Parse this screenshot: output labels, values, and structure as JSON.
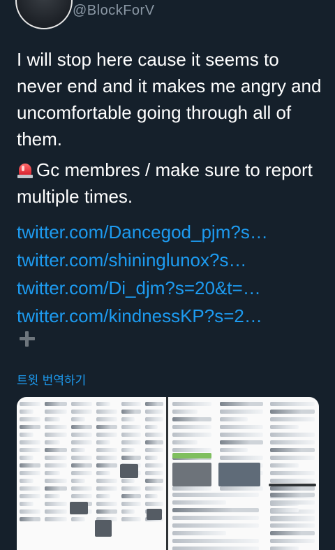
{
  "header": {
    "handle": "@BlockForV"
  },
  "tweet": {
    "paragraph1": "I will stop here cause it seems to never end and it makes me angry and uncomfortable going through all of them.",
    "paragraph2_icon": "police-car-light-icon",
    "paragraph2": "Gc membres / make sure to report multiple times.",
    "links": [
      "twitter.com/Dancegod_pjm?s…",
      "twitter.com/shininglunox?s…",
      "twitter.com/Di_djm?s=20&t=…",
      "twitter.com/kindnessKP?s=2…"
    ]
  },
  "actions": {
    "expand_icon": "plus-icon",
    "translate_label": "트윗 번역하기"
  },
  "colors": {
    "background": "#15202b",
    "link": "#1d9bf0",
    "muted": "#8b98a5"
  }
}
